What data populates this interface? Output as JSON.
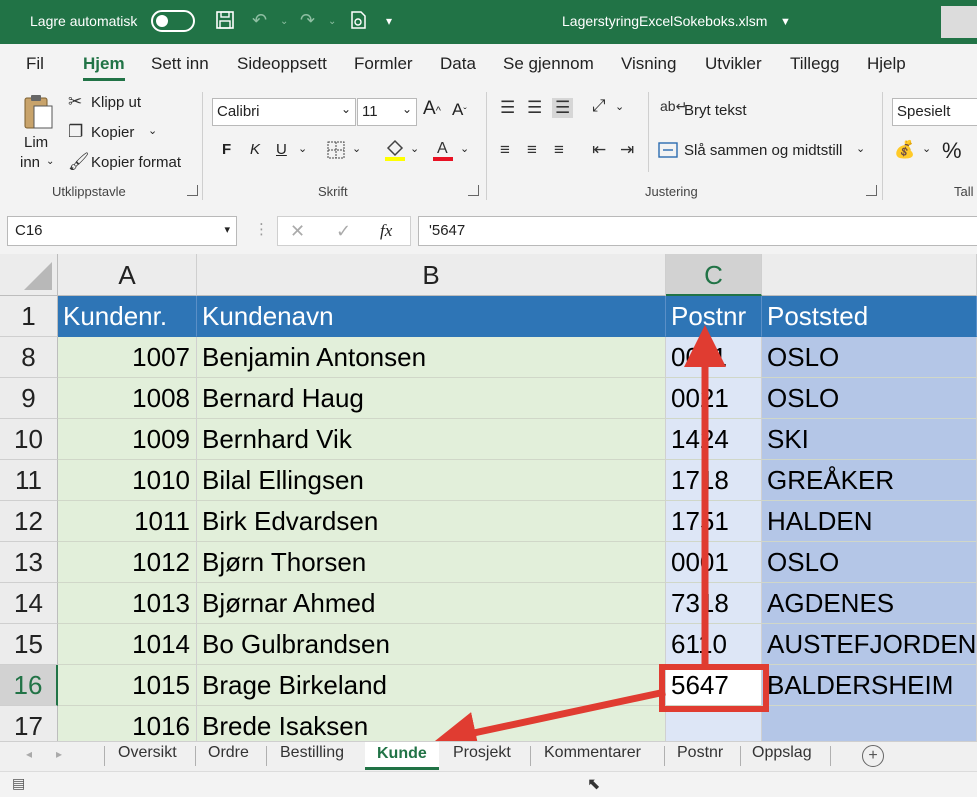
{
  "titlebar": {
    "autosave_label": "Lagre automatisk",
    "filename": "LagerstyringExcelSokeboks.xlsm",
    "colors": {
      "bg": "#217346"
    }
  },
  "ribbon_tabs": [
    "Fil",
    "Hjem",
    "Sett inn",
    "Sideoppsett",
    "Formler",
    "Data",
    "Se gjennom",
    "Visning",
    "Utvikler",
    "Tillegg",
    "Hjelp"
  ],
  "ribbon": {
    "clipboard": {
      "paste_line1": "Lim",
      "paste_line2": "inn",
      "cut": "Klipp ut",
      "copy": "Kopier",
      "format_painter": "Kopier format",
      "group_label": "Utklippstavle"
    },
    "font": {
      "font_name": "Calibri",
      "font_size": "11",
      "bold": "F",
      "italic": "K",
      "underline": "U",
      "group_label": "Skrift"
    },
    "alignment": {
      "wrap_text": "Bryt tekst",
      "merge_center": "Slå sammen og midtstill",
      "group_label": "Justering"
    },
    "number": {
      "format": "Spesielt",
      "percent": "%",
      "group_label": "Tall"
    }
  },
  "formula_bar": {
    "name_box": "C16",
    "fx": "fx",
    "formula": "'5647"
  },
  "columns": [
    "A",
    "B",
    "C"
  ],
  "header_row": {
    "row": "1",
    "a": "Kundenr.",
    "b": "Kundenavn",
    "c": "Postnr",
    "d": "Poststed"
  },
  "rows": [
    {
      "row": "8",
      "a": "1007",
      "b": "Benjamin Antonsen",
      "c": "0011",
      "d": "OSLO"
    },
    {
      "row": "9",
      "a": "1008",
      "b": "Bernard Haug",
      "c": "0021",
      "d": "OSLO"
    },
    {
      "row": "10",
      "a": "1009",
      "b": "Bernhard Vik",
      "c": "1424",
      "d": "SKI"
    },
    {
      "row": "11",
      "a": "1010",
      "b": "Bilal Ellingsen",
      "c": "1718",
      "d": "GREÅKER"
    },
    {
      "row": "12",
      "a": "1011",
      "b": "Birk Edvardsen",
      "c": "1751",
      "d": "HALDEN"
    },
    {
      "row": "13",
      "a": "1012",
      "b": "Bjørn Thorsen",
      "c": "0001",
      "d": "OSLO"
    },
    {
      "row": "14",
      "a": "1013",
      "b": "Bjørnar Ahmed",
      "c": "7318",
      "d": "AGDENES"
    },
    {
      "row": "15",
      "a": "1014",
      "b": "Bo Gulbrandsen",
      "c": "6110",
      "d": "AUSTEFJORDEN"
    },
    {
      "row": "16",
      "a": "1015",
      "b": "Brage Birkeland",
      "c": "5647",
      "d": "BALDERSHEIM"
    },
    {
      "row": "17",
      "a": "1016",
      "b": "Brede Isaksen",
      "c": "",
      "d": ""
    }
  ],
  "selected_row": "16",
  "selected_col": "C",
  "sheet_tabs": [
    "Oversikt",
    "Ordre",
    "Bestilling",
    "Kunde",
    "Prosjekt",
    "Kommentarer",
    "Postnr",
    "Oppslag"
  ],
  "active_sheet": "Kunde",
  "colors": {
    "header_blue": "#2e75b6",
    "col_a_b_fill": "#e2efda",
    "col_c_fill": "#dde6f6",
    "col_d_fill": "#b4c6e7",
    "arrow_red": "#e03c31",
    "excel_green": "#217346"
  }
}
